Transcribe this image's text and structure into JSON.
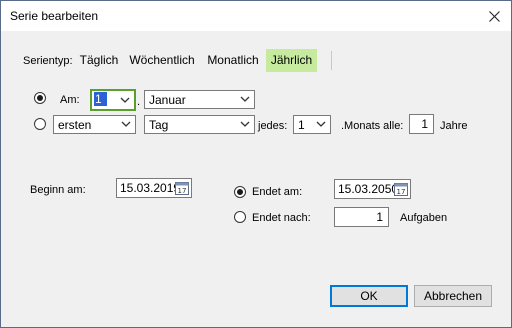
{
  "window": {
    "title": "Serie bearbeiten"
  },
  "series_type": {
    "label": "Serientyp:",
    "tabs": [
      {
        "label": "Täglich",
        "active": false
      },
      {
        "label": "Wöchentlich",
        "active": false
      },
      {
        "label": "Monatlich",
        "active": false
      },
      {
        "label": "Jährlich",
        "active": true
      }
    ]
  },
  "option_am": {
    "label": "Am:",
    "day_value": "1",
    "dot": ".",
    "month_value": "Januar",
    "selected": true
  },
  "option_relative": {
    "ordinal_value": "ersten",
    "weekday_value": "Tag",
    "jedes_label": "jedes:",
    "month_number_value": "1",
    "monats_label": ".Monats alle:",
    "years_value": "1",
    "years_label": "Jahre",
    "selected": false
  },
  "range": {
    "start_label": "Beginn am:",
    "start_value": "15.03.2019",
    "end_date_label": "Endet am:",
    "end_date_value": "15.03.2050",
    "end_date_selected": true,
    "end_after_label": "Endet nach:",
    "end_after_value": "1",
    "end_after_unit": "Aufgaben",
    "end_after_selected": false
  },
  "buttons": {
    "ok": "OK",
    "cancel": "Abbrechen"
  },
  "colors": {
    "active_tab": "#c7eb9e",
    "focus_border": "#5aa02c",
    "selection": "#2a62d6",
    "default_button_border": "#0078d7"
  }
}
